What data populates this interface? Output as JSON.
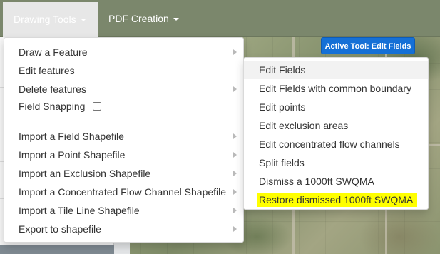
{
  "navbar": {
    "items": [
      {
        "label": "Drawing Tools",
        "active": true
      },
      {
        "label": "PDF Creation",
        "active": false
      }
    ]
  },
  "active_tool_badge": "Active Tool: Edit Fields",
  "drawing_menu": {
    "items": [
      {
        "label": "Draw a Feature",
        "submenu": true
      },
      {
        "label": "Edit features",
        "submenu": false
      },
      {
        "label": "Delete features",
        "submenu": true
      },
      {
        "label": "Field Snapping",
        "checkbox": true,
        "checked": false
      },
      {
        "label": "Import a Field Shapefile",
        "submenu": true
      },
      {
        "label": "Import a Point Shapefile",
        "submenu": true
      },
      {
        "label": "Import an Exclusion Shapefile",
        "submenu": true
      },
      {
        "label": "Import a Concentrated Flow Channel Shapefile",
        "submenu": true
      },
      {
        "label": "Import a Tile Line Shapefile",
        "submenu": true
      },
      {
        "label": "Export to shapefile",
        "submenu": true
      }
    ]
  },
  "edit_submenu": {
    "items": [
      {
        "label": "Edit Fields",
        "hovered": true
      },
      {
        "label": "Edit Fields with common boundary"
      },
      {
        "label": "Edit points"
      },
      {
        "label": "Edit exclusion areas"
      },
      {
        "label": "Edit concentrated flow channels"
      },
      {
        "label": "Split fields"
      },
      {
        "label": "Dismiss a 1000ft SWQMA"
      },
      {
        "label": "Restore dismissed 1000ft SWQMA",
        "highlighted": true
      }
    ]
  },
  "colors": {
    "navbar": "#7b876c",
    "badge": "#1570d6",
    "highlight": "#ffff00"
  }
}
